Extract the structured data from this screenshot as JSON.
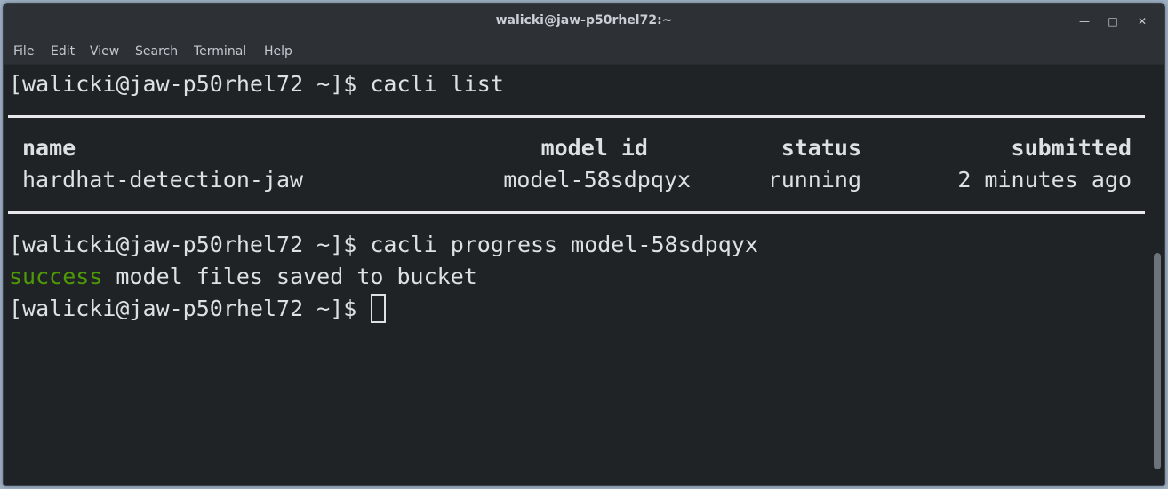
{
  "window": {
    "title": "walicki@jaw-p50rhel72:~"
  },
  "menu": [
    "File",
    "Edit",
    "View",
    "Search",
    "Terminal",
    "Help"
  ],
  "lines": {
    "cmd1": "[walicki@jaw-p50rhel72 ~]$ cacli list",
    "cmd2": "[walicki@jaw-p50rhel72 ~]$ cacli progress model-58sdpqyx",
    "success_word": "success",
    "success_rest": " model files saved to bucket",
    "prompt": "[walicki@jaw-p50rhel72 ~]$ "
  },
  "table": {
    "headers": {
      "name": "name",
      "model_id": "model id",
      "status": "status",
      "submitted": "submitted"
    },
    "rows": [
      {
        "name": "hardhat-detection-jaw",
        "model_id": "model-58sdpqyx",
        "status": "running",
        "submitted": "2 minutes ago"
      }
    ]
  },
  "colors": {
    "background": "#1f2326",
    "foreground": "#dde1e4",
    "success": "#4e9a06"
  }
}
